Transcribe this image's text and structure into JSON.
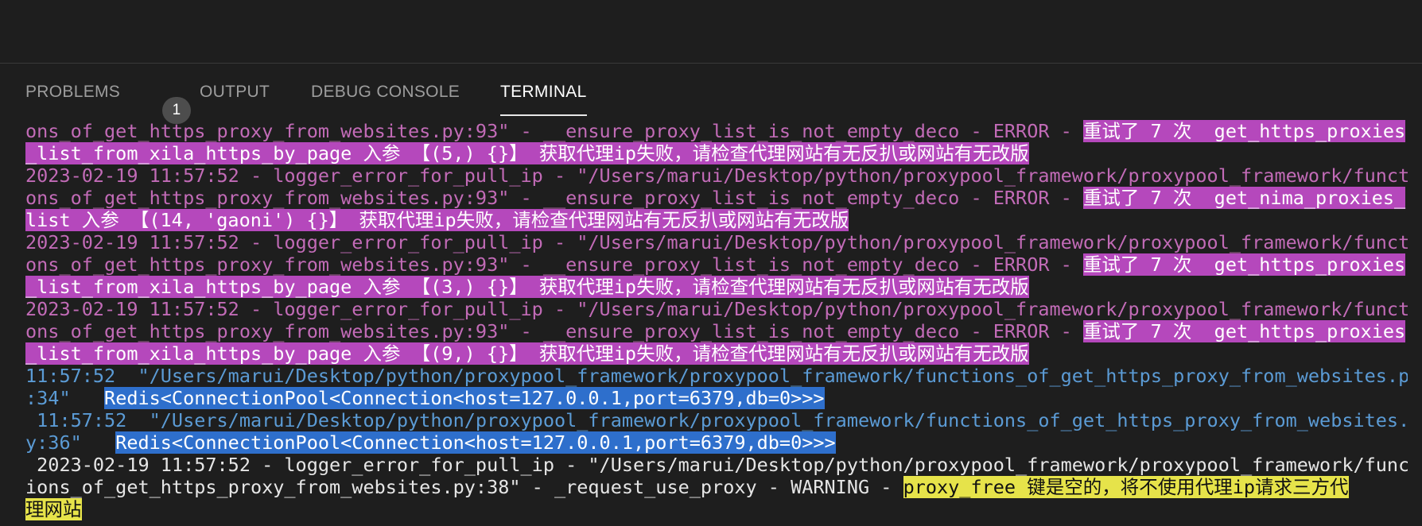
{
  "tabs": [
    {
      "label": "PROBLEMS",
      "badge": "1"
    },
    {
      "label": "OUTPUT"
    },
    {
      "label": "DEBUG CONSOLE"
    },
    {
      "label": "TERMINAL"
    }
  ],
  "terminal": {
    "lines": [
      {
        "segments": [
          {
            "text": "ons_of_get_https_proxy_from_websites.py:93\" - __ensure_proxy_list_is_not_empty_deco - ERROR - ",
            "style": "pink"
          },
          {
            "text": "重试了 7 次  get_https_proxies",
            "style": "hl-mag"
          }
        ]
      },
      {
        "segments": [
          {
            "text": "_list_from_xila_https_by_page 入参 【(5,) {}】 获取代理ip失败，请检查代理网站有无反扒或网站有无改版",
            "style": "hl-mag"
          }
        ]
      },
      {
        "segments": [
          {
            "text": "2023-02-19 11:57:52 - logger_error_for_pull_ip - \"/Users/marui/Desktop/python/proxypool_framework/proxypool_framework/functi",
            "style": "pink"
          }
        ]
      },
      {
        "segments": [
          {
            "text": "ons_of_get_https_proxy_from_websites.py:93\" - __ensure_proxy_list_is_not_empty_deco - ERROR - ",
            "style": "pink"
          },
          {
            "text": "重试了 7 次  get_nima_proxies_",
            "style": "hl-mag"
          }
        ]
      },
      {
        "segments": [
          {
            "text": "list 入参 【(14, 'gaoni') {}】 获取代理ip失败，请检查代理网站有无反扒或网站有无改版",
            "style": "hl-mag"
          }
        ]
      },
      {
        "segments": [
          {
            "text": "2023-02-19 11:57:52 - logger_error_for_pull_ip - \"/Users/marui/Desktop/python/proxypool_framework/proxypool_framework/functi",
            "style": "pink"
          }
        ]
      },
      {
        "segments": [
          {
            "text": "ons_of_get_https_proxy_from_websites.py:93\" - __ensure_proxy_list_is_not_empty_deco - ERROR - ",
            "style": "pink"
          },
          {
            "text": "重试了 7 次  get_https_proxies",
            "style": "hl-mag"
          }
        ]
      },
      {
        "segments": [
          {
            "text": "_list_from_xila_https_by_page 入参 【(3,) {}】 获取代理ip失败，请检查代理网站有无反扒或网站有无改版",
            "style": "hl-mag"
          }
        ]
      },
      {
        "segments": [
          {
            "text": "2023-02-19 11:57:52 - logger_error_for_pull_ip - \"/Users/marui/Desktop/python/proxypool_framework/proxypool_framework/functi",
            "style": "pink"
          }
        ]
      },
      {
        "segments": [
          {
            "text": "ons_of_get_https_proxy_from_websites.py:93\" - __ensure_proxy_list_is_not_empty_deco - ERROR - ",
            "style": "pink"
          },
          {
            "text": "重试了 7 次  get_https_proxies",
            "style": "hl-mag"
          }
        ]
      },
      {
        "segments": [
          {
            "text": "_list_from_xila_https_by_page 入参 【(9,) {}】 获取代理ip失败，请检查代理网站有无反扒或网站有无改版",
            "style": "hl-mag"
          }
        ]
      },
      {
        "segments": [
          {
            "text": "11:57:52  \"/Users/marui/Desktop/python/proxypool_framework/proxypool_framework/functions_of_get_https_proxy_from_websites.py",
            "style": "blue"
          }
        ]
      },
      {
        "segments": [
          {
            "text": ":34\"   ",
            "style": "blue"
          },
          {
            "text": "Redis<ConnectionPool<Connection<host=127.0.0.1,port=6379,db=0>>>",
            "style": "hl-blue"
          }
        ]
      },
      {
        "segments": [
          {
            "text": " 11:57:52  \"/Users/marui/Desktop/python/proxypool_framework/proxypool_framework/functions_of_get_https_proxy_from_websites.p",
            "style": "blue"
          }
        ]
      },
      {
        "segments": [
          {
            "text": "y:36\"   ",
            "style": "blue"
          },
          {
            "text": "Redis<ConnectionPool<Connection<host=127.0.0.1,port=6379,db=0>>>",
            "style": "hl-blue"
          }
        ]
      },
      {
        "segments": [
          {
            "text": " 2023-02-19 11:57:52 - logger_error_for_pull_ip - \"/Users/marui/Desktop/python/proxypool_framework/proxypool_framework/funct",
            "style": "white"
          }
        ]
      },
      {
        "segments": [
          {
            "text": "ions_of_get_https_proxy_from_websites.py:38\" - _request_use_proxy - WARNING - ",
            "style": "white"
          },
          {
            "text": "proxy_free 键是空的，将不使用代理ip请求三方代",
            "style": "hl-yel"
          }
        ]
      },
      {
        "segments": [
          {
            "text": "理网站",
            "style": "hl-yel"
          }
        ]
      }
    ]
  }
}
